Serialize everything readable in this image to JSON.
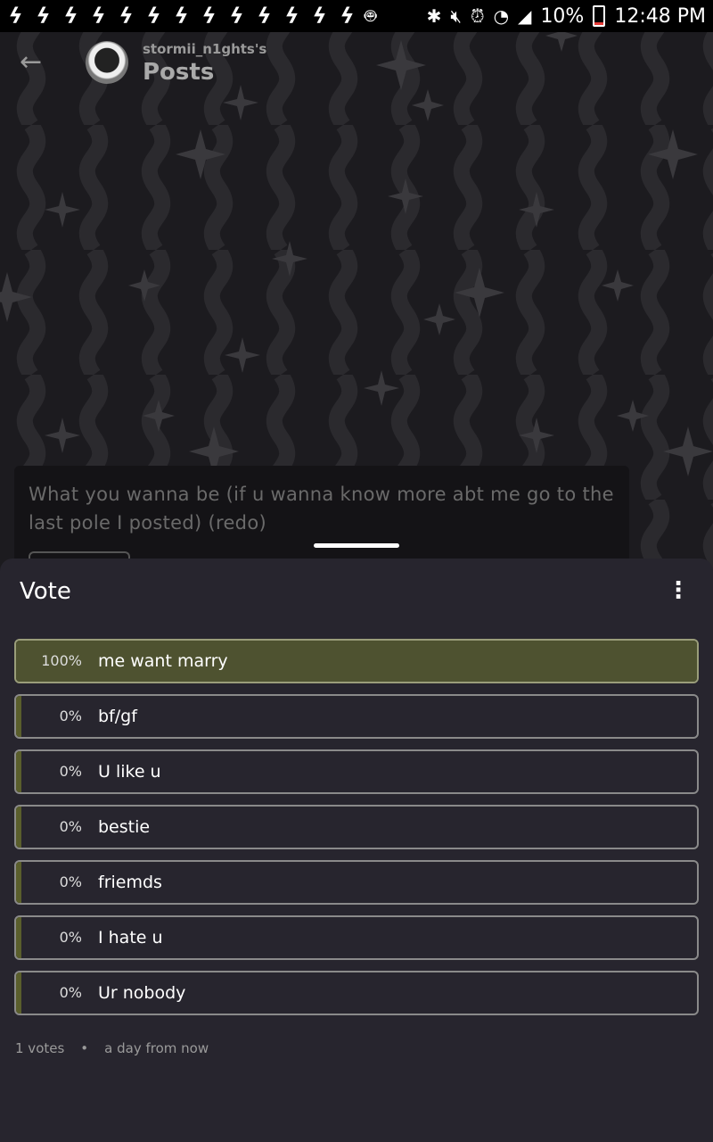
{
  "status_bar": {
    "notification_icons": [
      "bolt-icon",
      "bolt-icon",
      "bolt-icon",
      "bolt-icon",
      "bolt-icon",
      "bolt-icon",
      "bolt-icon",
      "bolt-icon",
      "bolt-icon",
      "bolt-icon",
      "bolt-icon",
      "bolt-icon",
      "bolt-icon"
    ],
    "battery": "10%",
    "time": "12:48 PM"
  },
  "header": {
    "owner": "stormii_n1ghts's",
    "title": "Posts"
  },
  "post": {
    "text": "What you wanna be (if u wanna know more abt me go to the last pole I posted) (redo)"
  },
  "poll": {
    "title": "Vote",
    "options": [
      {
        "percent": "100%",
        "label": "me want marry",
        "share": 1.0
      },
      {
        "percent": "0%",
        "label": "bf/gf",
        "share": 0
      },
      {
        "percent": "0%",
        "label": "U like u",
        "share": 0
      },
      {
        "percent": "0%",
        "label": "bestie",
        "share": 0
      },
      {
        "percent": "0%",
        "label": "friemds",
        "share": 0
      },
      {
        "percent": "0%",
        "label": "I hate u",
        "share": 0
      },
      {
        "percent": "0%",
        "label": "Ur nobody",
        "share": 0
      }
    ],
    "votes": "1 votes",
    "separator": "•",
    "deadline": "a day from now"
  },
  "colors": {
    "accent_fill": "#4e5230",
    "sheet_bg": "#27252e"
  }
}
